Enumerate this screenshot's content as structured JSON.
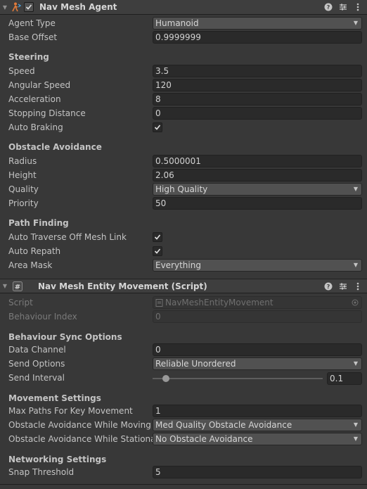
{
  "nav_mesh_agent": {
    "title": "Nav Mesh Agent",
    "agent_type_label": "Agent Type",
    "agent_type_value": "Humanoid",
    "base_offset_label": "Base Offset",
    "base_offset_value": "0.9999999",
    "steering_header": "Steering",
    "speed_label": "Speed",
    "speed_value": "3.5",
    "angular_speed_label": "Angular Speed",
    "angular_speed_value": "120",
    "acceleration_label": "Acceleration",
    "acceleration_value": "8",
    "stopping_distance_label": "Stopping Distance",
    "stopping_distance_value": "0",
    "auto_braking_label": "Auto Braking",
    "obstacle_header": "Obstacle Avoidance",
    "radius_label": "Radius",
    "radius_value": "0.5000001",
    "height_label": "Height",
    "height_value": "2.06",
    "quality_label": "Quality",
    "quality_value": "High Quality",
    "priority_label": "Priority",
    "priority_value": "50",
    "path_header": "Path Finding",
    "auto_traverse_label": "Auto Traverse Off Mesh Link",
    "auto_repath_label": "Auto Repath",
    "area_mask_label": "Area Mask",
    "area_mask_value": "Everything"
  },
  "entity_movement": {
    "title": "Nav Mesh Entity Movement (Script)",
    "script_label": "Script",
    "script_value": "NavMeshEntityMovement",
    "behaviour_index_label": "Behaviour Index",
    "behaviour_index_value": "0",
    "sync_header": "Behaviour Sync Options",
    "data_channel_label": "Data Channel",
    "data_channel_value": "0",
    "send_options_label": "Send Options",
    "send_options_value": "Reliable Unordered",
    "send_interval_label": "Send Interval",
    "send_interval_value": "0.1",
    "movement_header": "Movement Settings",
    "max_paths_label": "Max Paths For Key Movement",
    "max_paths_value": "1",
    "avoid_moving_label": "Obstacle Avoidance While Moving",
    "avoid_moving_value": "Med Quality Obstacle Avoidance",
    "avoid_stationary_label": "Obstacle Avoidance While Stationar",
    "avoid_stationary_value": "No Obstacle Avoidance",
    "networking_header": "Networking Settings",
    "snap_label": "Snap Threshold",
    "snap_value": "5"
  },
  "checks": {
    "auto_braking": true,
    "auto_traverse": true,
    "auto_repath": true,
    "nav_agent_enabled": true
  },
  "slider": {
    "send_interval_fraction": 0.06
  },
  "colors": {
    "background": "#383838",
    "header": "#3e3e3e",
    "field": "#2a2a2a",
    "dropdown": "#515151"
  }
}
